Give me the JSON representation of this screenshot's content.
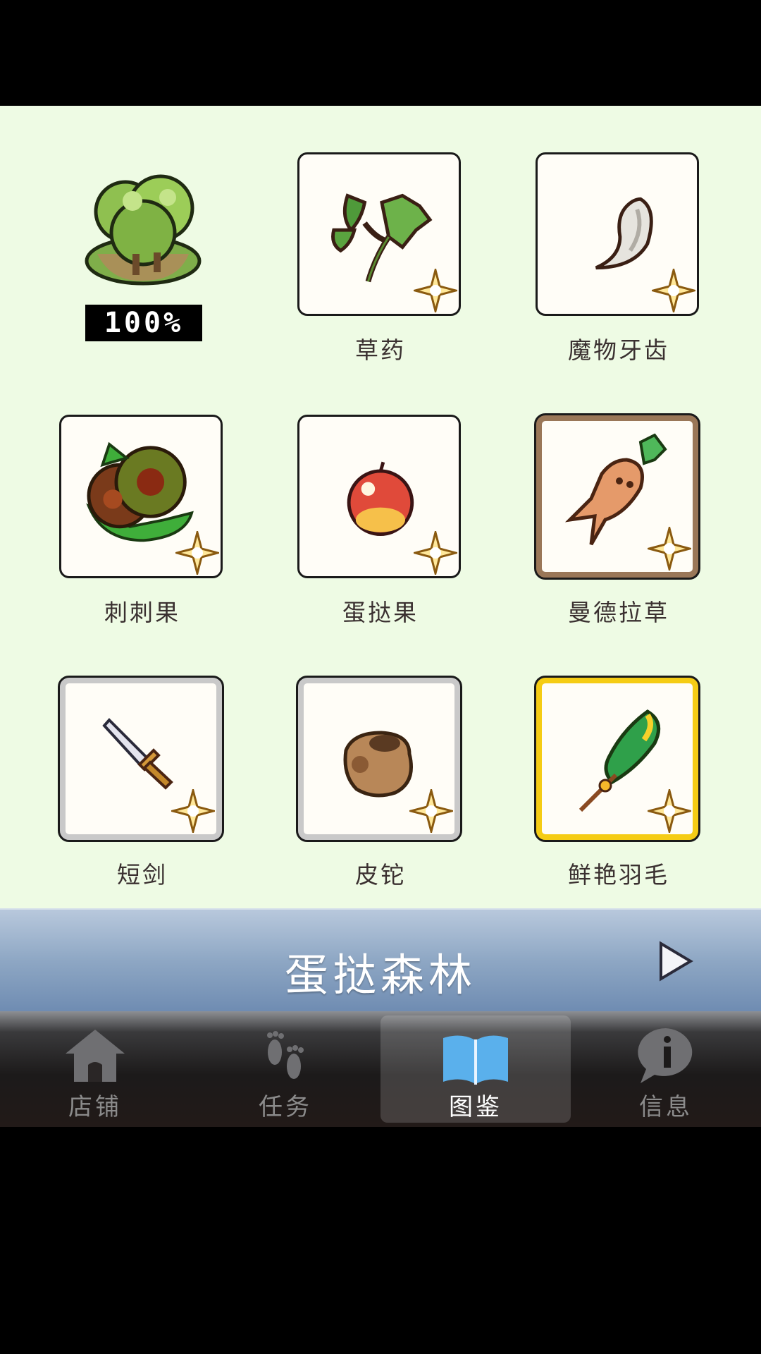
{
  "area": {
    "completion": "100%"
  },
  "items": [
    {
      "name": "草药",
      "icon": "herb-leaf-icon",
      "frame": "plain"
    },
    {
      "name": "魔物牙齿",
      "icon": "monster-fang-icon",
      "frame": "plain"
    },
    {
      "name": "刺刺果",
      "icon": "spiky-fruit-icon",
      "frame": "plain"
    },
    {
      "name": "蛋挞果",
      "icon": "red-apple-icon",
      "frame": "plain"
    },
    {
      "name": "曼德拉草",
      "icon": "mandrake-root-icon",
      "frame": "brown"
    },
    {
      "name": "短剑",
      "icon": "short-sword-icon",
      "frame": "silver"
    },
    {
      "name": "皮铊",
      "icon": "leather-pouch-icon",
      "frame": "silver"
    },
    {
      "name": "鲜艳羽毛",
      "icon": "bright-feather-icon",
      "frame": "gold"
    }
  ],
  "region": {
    "title": "蛋挞森林",
    "next_icon": "play-arrow-icon"
  },
  "tabs": [
    {
      "label": "店铺",
      "icon": "house-icon"
    },
    {
      "label": "任务",
      "icon": "footprints-icon"
    },
    {
      "label": "图鉴",
      "icon": "open-book-icon",
      "active": true
    },
    {
      "label": "信息",
      "icon": "info-bubble-icon"
    }
  ],
  "colors": {
    "background": "#eefbe4",
    "gold_frame": "#f5cc14",
    "brown_frame": "#9a7758",
    "silver_frame": "#c9c9c9",
    "bar_blue": "#8ea7c4"
  }
}
